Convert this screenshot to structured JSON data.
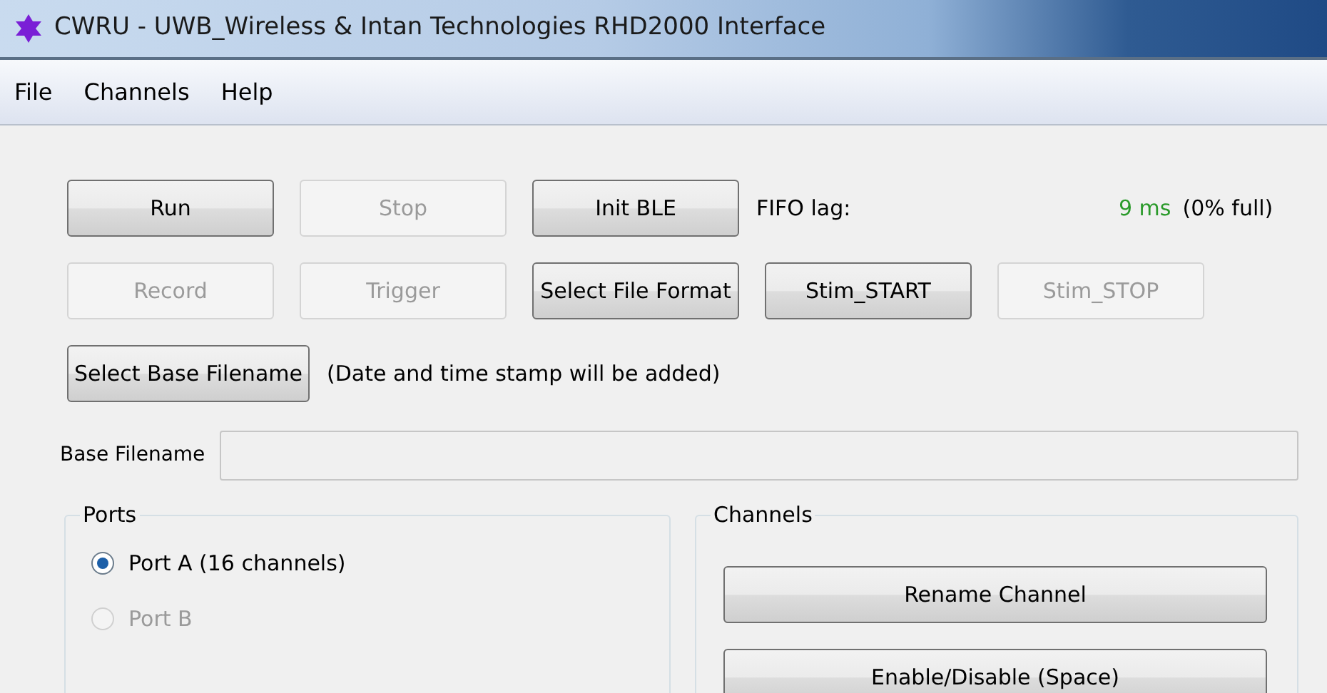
{
  "window": {
    "title": "CWRU - UWB_Wireless & Intan Technologies RHD2000 Interface"
  },
  "menu": [
    "File",
    "Channels",
    "Help"
  ],
  "control_rows": [
    [
      {
        "kind": "button",
        "label": "Run",
        "disabled": false
      },
      {
        "kind": "button",
        "label": "Stop",
        "disabled": true
      },
      {
        "kind": "button",
        "label": "Init BLE",
        "disabled": false
      },
      {
        "kind": "fifo",
        "label": "FIFO lag:",
        "lag": "9 ms",
        "fill": "(0% full)"
      }
    ],
    [
      {
        "kind": "button",
        "label": "Record",
        "disabled": true
      },
      {
        "kind": "button",
        "label": "Trigger",
        "disabled": true
      },
      {
        "kind": "button",
        "label": "Select File Format",
        "disabled": false
      },
      {
        "kind": "button",
        "label": "Stim_START",
        "disabled": false
      },
      {
        "kind": "button",
        "label": "Stim_STOP",
        "disabled": true
      }
    ],
    [
      {
        "kind": "button",
        "label": "Select Base Filename",
        "disabled": false
      },
      {
        "kind": "note",
        "label": "(Date and time stamp will be added)"
      }
    ]
  ],
  "base_filename": {
    "label": "Base Filename"
  },
  "ports": {
    "title": "Ports",
    "options": [
      {
        "label": "Port A (16 channels)",
        "selected": true,
        "disabled": false
      },
      {
        "label": "Port B",
        "selected": false,
        "disabled": true
      }
    ]
  },
  "channels": {
    "title": "Channels",
    "buttons": [
      "Rename Channel",
      "Enable/Disable (Space)"
    ]
  }
}
